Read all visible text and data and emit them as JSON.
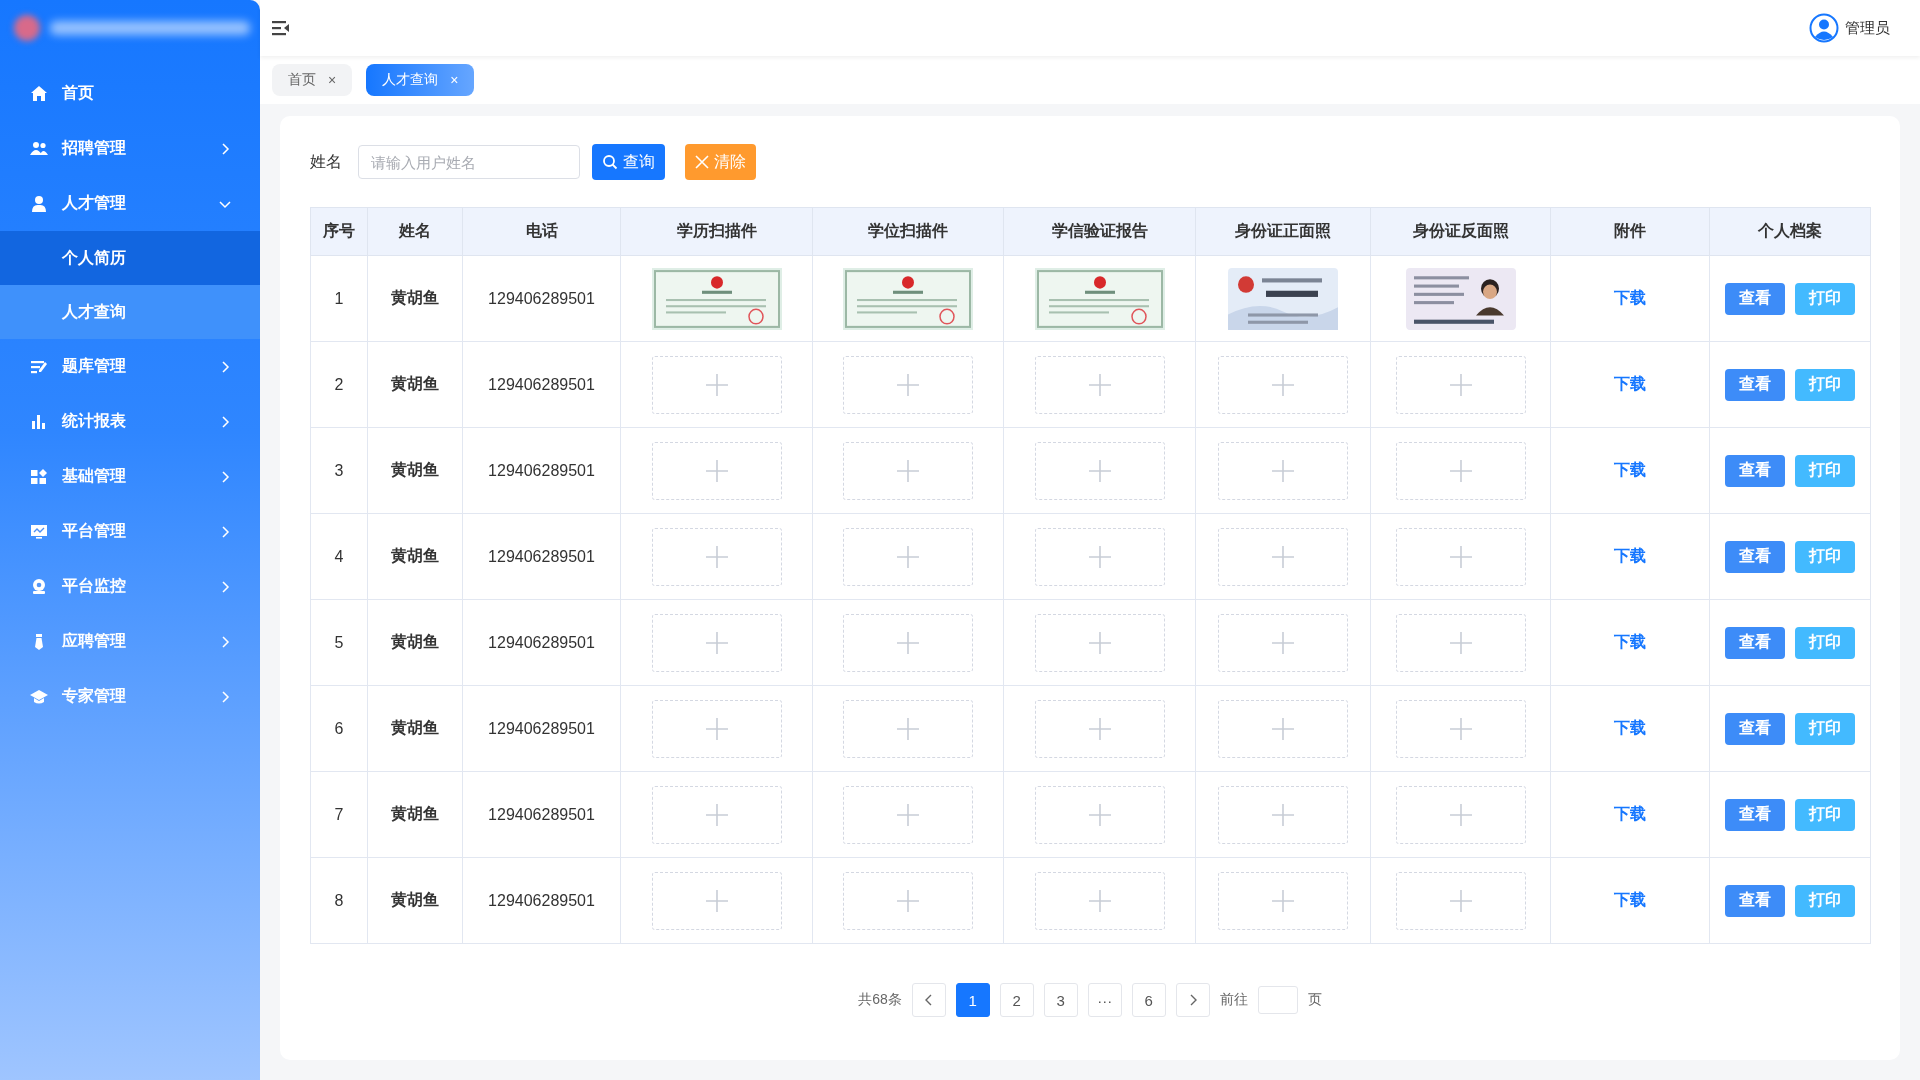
{
  "header": {
    "user": "管理员"
  },
  "sidebar": {
    "items": [
      {
        "label": "首页",
        "kind": "link"
      },
      {
        "label": "招聘管理",
        "kind": "group",
        "expanded": false
      },
      {
        "label": "人才管理",
        "kind": "group",
        "expanded": true,
        "children": [
          {
            "label": "个人简历",
            "selected": true
          },
          {
            "label": "人才查询",
            "selected": false
          }
        ]
      },
      {
        "label": "题库管理",
        "kind": "group",
        "expanded": false
      },
      {
        "label": "统计报表",
        "kind": "group",
        "expanded": false
      },
      {
        "label": "基础管理",
        "kind": "group",
        "expanded": false
      },
      {
        "label": "平台管理",
        "kind": "group",
        "expanded": false
      },
      {
        "label": "平台监控",
        "kind": "group",
        "expanded": false
      },
      {
        "label": "应聘管理",
        "kind": "group",
        "expanded": false
      },
      {
        "label": "专家管理",
        "kind": "group",
        "expanded": false
      }
    ]
  },
  "tabs": [
    {
      "label": "首页",
      "close": "×",
      "selected": false
    },
    {
      "label": "人才查询",
      "close": "×",
      "selected": true
    }
  ],
  "search": {
    "label": "姓名",
    "placeholder": "请输入用户姓名",
    "buttons": [
      {
        "label": "查询",
        "kind": "primary"
      },
      {
        "label": "清除",
        "kind": "warning"
      }
    ]
  },
  "table": {
    "columns": [
      "序号",
      "姓名",
      "电话",
      "学历扫描件",
      "学位扫描件",
      "学信验证报告",
      "身份证正面照",
      "身份证反面照",
      "附件",
      "个人档案"
    ],
    "rows": [
      {
        "index": "1",
        "name": "黄胡鱼",
        "phone": "129406289501",
        "attachment": "下载",
        "actions": [
          "查看",
          "打印"
        ]
      },
      {
        "index": "2",
        "name": "黄胡鱼",
        "phone": "129406289501",
        "files": [
          {
            "kind": "upload"
          },
          {
            "kind": "upload"
          },
          {
            "kind": "upload"
          },
          {
            "kind": "upload"
          },
          {
            "kind": "upload"
          }
        ],
        "attachment": "下载",
        "actions": [
          "查看",
          "打印"
        ]
      },
      {
        "index": "3",
        "name": "黄胡鱼",
        "phone": "129406289501",
        "files": [
          {
            "kind": "upload"
          },
          {
            "kind": "upload"
          },
          {
            "kind": "upload"
          },
          {
            "kind": "upload"
          },
          {
            "kind": "upload"
          }
        ],
        "attachment": "下载",
        "actions": [
          "查看",
          "打印"
        ]
      },
      {
        "index": "4",
        "name": "黄胡鱼",
        "phone": "129406289501",
        "files": [
          {
            "kind": "upload"
          },
          {
            "kind": "upload"
          },
          {
            "kind": "upload"
          },
          {
            "kind": "upload"
          },
          {
            "kind": "upload"
          }
        ],
        "attachment": "下载",
        "actions": [
          "查看",
          "打印"
        ]
      },
      {
        "index": "5",
        "name": "黄胡鱼",
        "phone": "129406289501",
        "files": [
          {
            "kind": "upload"
          },
          {
            "kind": "upload"
          },
          {
            "kind": "upload"
          },
          {
            "kind": "upload"
          },
          {
            "kind": "upload"
          }
        ],
        "attachment": "下载",
        "actions": [
          "查看",
          "打印"
        ]
      },
      {
        "index": "6",
        "name": "黄胡鱼",
        "phone": "129406289501",
        "files": [
          {
            "kind": "upload"
          },
          {
            "kind": "upload"
          },
          {
            "kind": "upload"
          },
          {
            "kind": "upload"
          },
          {
            "kind": "upload"
          }
        ],
        "attachment": "下载",
        "actions": [
          "查看",
          "打印"
        ]
      },
      {
        "index": "7",
        "name": "黄胡鱼",
        "phone": "129406289501",
        "files": [
          {
            "kind": "upload"
          },
          {
            "kind": "upload"
          },
          {
            "kind": "upload"
          },
          {
            "kind": "upload"
          },
          {
            "kind": "upload"
          }
        ],
        "attachment": "下载",
        "actions": [
          "查看",
          "打印"
        ]
      },
      {
        "index": "8",
        "name": "黄胡鱼",
        "phone": "129406289501",
        "files": [
          {
            "kind": "upload"
          },
          {
            "kind": "upload"
          },
          {
            "kind": "upload"
          },
          {
            "kind": "upload"
          },
          {
            "kind": "upload"
          }
        ],
        "attachment": "下载",
        "actions": [
          "查看",
          "打印"
        ]
      }
    ]
  },
  "pagination": {
    "total": "共68条",
    "pages": [
      {
        "label": "1",
        "selected": true
      },
      {
        "label": "2",
        "selected": false
      },
      {
        "label": "3",
        "selected": false
      },
      {
        "label": "···",
        "selected": false
      },
      {
        "label": "6",
        "selected": false
      }
    ],
    "goto": "前往",
    "unit": "页"
  }
}
